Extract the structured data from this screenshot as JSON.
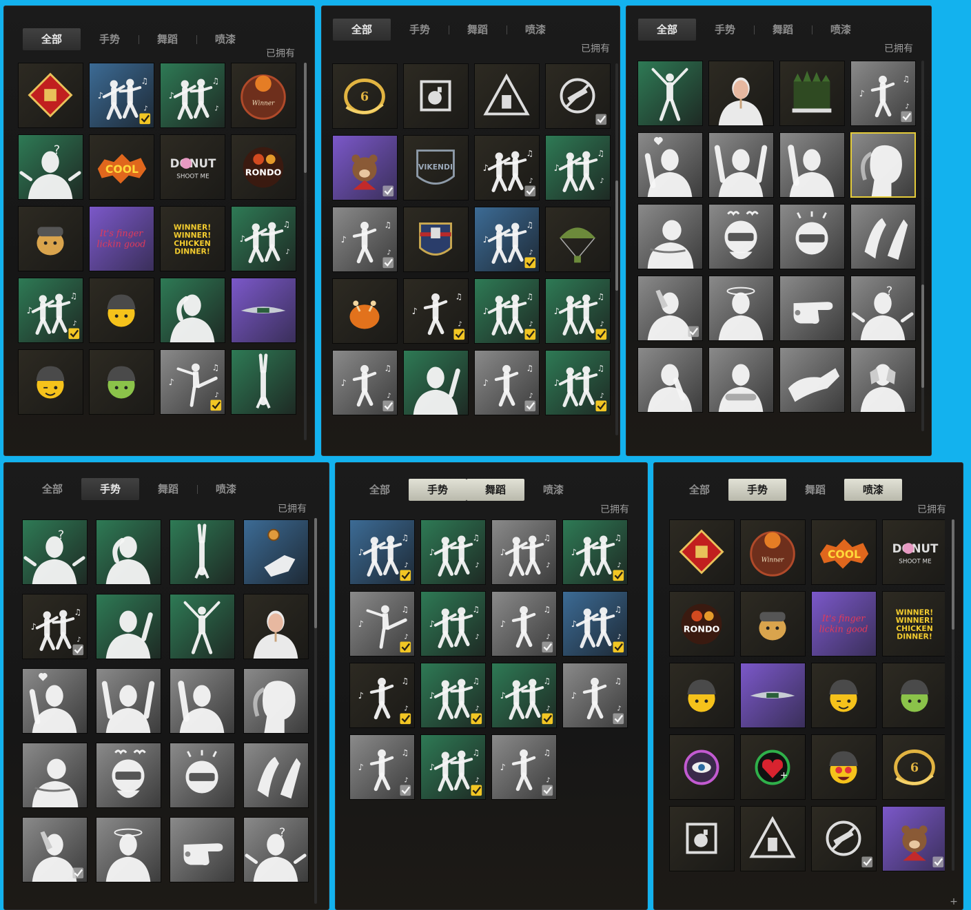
{
  "colors": {
    "page_bg": "#13b2ee",
    "panel_bg": "#181818",
    "selected_border": "#e5cc3a",
    "check": "#f2c624"
  },
  "panels": [
    {
      "tabs": [
        "全部",
        "手势",
        "舞蹈",
        "喷漆"
      ],
      "active_tabs": [
        "全部"
      ],
      "owned_label": "已拥有",
      "items": [
        {
          "bg": "dark",
          "icon": "diamond-badge-icon"
        },
        {
          "bg": "blue",
          "icon": "two-dancers-icon",
          "check": "gold"
        },
        {
          "bg": "green",
          "icon": "two-dancers-icon"
        },
        {
          "bg": "dark",
          "icon": "chicken-dinner-badge-icon"
        },
        {
          "bg": "green",
          "icon": "shrug-gesture-icon"
        },
        {
          "bg": "dark",
          "icon": "cool-spray-icon"
        },
        {
          "bg": "dark",
          "icon": "donut-spray-icon"
        },
        {
          "bg": "dark",
          "icon": "rondo-spray-icon"
        },
        {
          "bg": "dark",
          "icon": "doge-spray-icon"
        },
        {
          "bg": "purple",
          "icon": "neon-text-spray-icon"
        },
        {
          "bg": "dark",
          "icon": "winner-text-spray-icon"
        },
        {
          "bg": "green",
          "icon": "two-dancers-icon"
        },
        {
          "bg": "green",
          "icon": "two-dancers-icon",
          "check": "gold"
        },
        {
          "bg": "dark",
          "icon": "helmet-emoji-icon"
        },
        {
          "bg": "green",
          "icon": "salute-gesture-icon"
        },
        {
          "bg": "purple",
          "icon": "wings-logo-icon"
        },
        {
          "bg": "dark",
          "icon": "wink-emoji-icon"
        },
        {
          "bg": "dark",
          "icon": "green-emoji-icon"
        },
        {
          "bg": "grey",
          "icon": "kick-dancer-icon",
          "check": "gold"
        },
        {
          "bg": "green",
          "icon": "handstand-icon"
        }
      ]
    },
    {
      "tabs": [
        "全部",
        "手势",
        "舞蹈",
        "喷漆"
      ],
      "active_tabs": [
        "全部"
      ],
      "owned_label": "已拥有",
      "items": [
        {
          "bg": "dark",
          "icon": "gold-emblem-icon"
        },
        {
          "bg": "dark",
          "icon": "grenade-icon"
        },
        {
          "bg": "dark",
          "icon": "triangle-emblem-icon"
        },
        {
          "bg": "dark",
          "icon": "no-gun-icon",
          "check": "grey"
        },
        {
          "bg": "purple",
          "icon": "bear-spray-icon",
          "check": "grey"
        },
        {
          "bg": "dark",
          "icon": "vikendi-emblem-icon"
        },
        {
          "bg": "dark",
          "icon": "two-dancers-icon",
          "check": "grey"
        },
        {
          "bg": "green",
          "icon": "two-dancers-icon"
        },
        {
          "bg": "grey",
          "icon": "solo-dancer-icon",
          "check": "grey"
        },
        {
          "bg": "dark",
          "icon": "shield-badge-icon"
        },
        {
          "bg": "blue",
          "icon": "two-dancers-icon",
          "check": "gold"
        },
        {
          "bg": "dark",
          "icon": "parachute-icon"
        },
        {
          "bg": "dark",
          "icon": "chicken-icon"
        },
        {
          "bg": "dark",
          "icon": "solo-dancer-icon",
          "check": "gold"
        },
        {
          "bg": "green",
          "icon": "two-dancers-icon",
          "check": "gold"
        },
        {
          "bg": "green",
          "icon": "two-dancers-icon",
          "check": "gold"
        },
        {
          "bg": "grey",
          "icon": "solo-dancer-icon",
          "check": "grey"
        },
        {
          "bg": "green",
          "icon": "point-gesture-icon"
        },
        {
          "bg": "grey",
          "icon": "solo-dancer-icon",
          "check": "grey"
        },
        {
          "bg": "green",
          "icon": "two-dancers-icon",
          "check": "gold"
        }
      ]
    },
    {
      "tabs": [
        "全部",
        "手势",
        "舞蹈",
        "喷漆"
      ],
      "active_tabs": [
        "全部"
      ],
      "owned_label": "已拥有",
      "items": [
        {
          "bg": "green",
          "icon": "star-pose-icon"
        },
        {
          "bg": "dark",
          "icon": "mask-gesture-icon"
        },
        {
          "bg": "dark",
          "icon": "forest-spray-icon"
        },
        {
          "bg": "grey",
          "icon": "solo-dancer-icon",
          "check": "grey"
        },
        {
          "bg": "grey",
          "icon": "heart-gesture-icon"
        },
        {
          "bg": "grey",
          "icon": "hands-up-icon"
        },
        {
          "bg": "grey",
          "icon": "wave-gesture-icon"
        },
        {
          "bg": "grey",
          "icon": "hair-flip-icon",
          "selected": true
        },
        {
          "bg": "grey",
          "icon": "bow-gesture-icon"
        },
        {
          "bg": "grey",
          "icon": "angry-helmet-icon"
        },
        {
          "bg": "grey",
          "icon": "nervous-helmet-icon"
        },
        {
          "bg": "grey",
          "icon": "clap-gesture-icon"
        },
        {
          "bg": "grey",
          "icon": "facepalm-gesture-icon",
          "check": "grey"
        },
        {
          "bg": "grey",
          "icon": "dizzy-gesture-icon"
        },
        {
          "bg": "grey",
          "icon": "point-finger-icon"
        },
        {
          "bg": "grey",
          "icon": "shrug-gesture-icon"
        },
        {
          "bg": "grey",
          "icon": "think-gesture-icon"
        },
        {
          "bg": "grey",
          "icon": "arms-crossed-icon"
        },
        {
          "bg": "grey",
          "icon": "flex-arm-icon"
        },
        {
          "bg": "grey",
          "icon": "cover-face-icon"
        }
      ]
    },
    {
      "tabs": [
        "全部",
        "手势",
        "舞蹈",
        "喷漆"
      ],
      "active_tabs": [
        "手势"
      ],
      "owned_label": "已拥有",
      "items": [
        {
          "bg": "green",
          "icon": "shrug-gesture-icon"
        },
        {
          "bg": "green",
          "icon": "salute-gesture-icon"
        },
        {
          "bg": "green",
          "icon": "handstand-icon"
        },
        {
          "bg": "blue",
          "icon": "coin-flip-icon"
        },
        {
          "bg": "dark",
          "icon": "two-dancers-icon",
          "check": "grey"
        },
        {
          "bg": "green",
          "icon": "point-gesture-icon"
        },
        {
          "bg": "green",
          "icon": "star-pose-icon"
        },
        {
          "bg": "dark",
          "icon": "mask-gesture-icon"
        },
        {
          "bg": "grey",
          "icon": "heart-gesture-icon"
        },
        {
          "bg": "grey",
          "icon": "hands-up-icon"
        },
        {
          "bg": "grey",
          "icon": "wave-gesture-icon"
        },
        {
          "bg": "grey",
          "icon": "hair-flip-icon"
        },
        {
          "bg": "grey",
          "icon": "bow-gesture-icon"
        },
        {
          "bg": "grey",
          "icon": "angry-helmet-icon"
        },
        {
          "bg": "grey",
          "icon": "nervous-helmet-icon"
        },
        {
          "bg": "grey",
          "icon": "clap-gesture-icon"
        },
        {
          "bg": "grey",
          "icon": "facepalm-gesture-icon",
          "check": "grey"
        },
        {
          "bg": "grey",
          "icon": "dizzy-gesture-icon"
        },
        {
          "bg": "grey",
          "icon": "point-finger-icon"
        },
        {
          "bg": "grey",
          "icon": "shrug-gesture-icon"
        }
      ]
    },
    {
      "tabs": [
        "全部",
        "手势",
        "舞蹈",
        "喷漆"
      ],
      "active_tabs": [
        "手势",
        "舞蹈"
      ],
      "owned_label": "已拥有",
      "items": [
        {
          "bg": "blue",
          "icon": "two-dancers-icon",
          "check": "gold"
        },
        {
          "bg": "green",
          "icon": "two-dancers-icon"
        },
        {
          "bg": "grey",
          "icon": "two-dancers-icon"
        },
        {
          "bg": "green",
          "icon": "two-dancers-icon",
          "check": "gold"
        },
        {
          "bg": "grey",
          "icon": "kick-dancer-icon",
          "check": "gold"
        },
        {
          "bg": "green",
          "icon": "two-dancers-icon"
        },
        {
          "bg": "grey",
          "icon": "solo-dancer-icon",
          "check": "grey"
        },
        {
          "bg": "blue",
          "icon": "two-dancers-icon",
          "check": "gold"
        },
        {
          "bg": "dark",
          "icon": "solo-dancer-icon",
          "check": "gold"
        },
        {
          "bg": "green",
          "icon": "two-dancers-icon",
          "check": "gold"
        },
        {
          "bg": "green",
          "icon": "two-dancers-icon",
          "check": "gold"
        },
        {
          "bg": "grey",
          "icon": "solo-dancer-icon",
          "check": "grey"
        },
        {
          "bg": "grey",
          "icon": "solo-dancer-icon",
          "check": "grey"
        },
        {
          "bg": "green",
          "icon": "two-dancers-icon",
          "check": "gold"
        },
        {
          "bg": "grey",
          "icon": "solo-dancer-icon",
          "check": "grey"
        }
      ]
    },
    {
      "tabs": [
        "全部",
        "手势",
        "舞蹈",
        "喷漆"
      ],
      "active_tabs": [
        "手势",
        "喷漆"
      ],
      "owned_label": "已拥有",
      "items": [
        {
          "bg": "dark",
          "icon": "diamond-badge-icon"
        },
        {
          "bg": "dark",
          "icon": "chicken-dinner-badge-icon"
        },
        {
          "bg": "dark",
          "icon": "cool-spray-icon"
        },
        {
          "bg": "dark",
          "icon": "donut-spray-icon"
        },
        {
          "bg": "dark",
          "icon": "rondo-spray-icon"
        },
        {
          "bg": "dark",
          "icon": "doge-spray-icon"
        },
        {
          "bg": "purple",
          "icon": "neon-text-spray-icon"
        },
        {
          "bg": "dark",
          "icon": "winner-text-spray-icon"
        },
        {
          "bg": "dark",
          "icon": "helmet-emoji-icon"
        },
        {
          "bg": "purple",
          "icon": "wings-logo-icon"
        },
        {
          "bg": "dark",
          "icon": "wink-emoji-icon"
        },
        {
          "bg": "dark",
          "icon": "green-emoji-icon"
        },
        {
          "bg": "dark",
          "icon": "eye-ring-icon"
        },
        {
          "bg": "dark",
          "icon": "heart-plus-icon"
        },
        {
          "bg": "dark",
          "icon": "heart-eyes-emoji-icon"
        },
        {
          "bg": "dark",
          "icon": "gold-emblem-icon"
        },
        {
          "bg": "dark",
          "icon": "grenade-icon"
        },
        {
          "bg": "dark",
          "icon": "triangle-emblem-icon"
        },
        {
          "bg": "dark",
          "icon": "no-gun-icon",
          "check": "grey"
        },
        {
          "bg": "purple",
          "icon": "bear-spray-icon",
          "check": "grey"
        }
      ]
    }
  ]
}
